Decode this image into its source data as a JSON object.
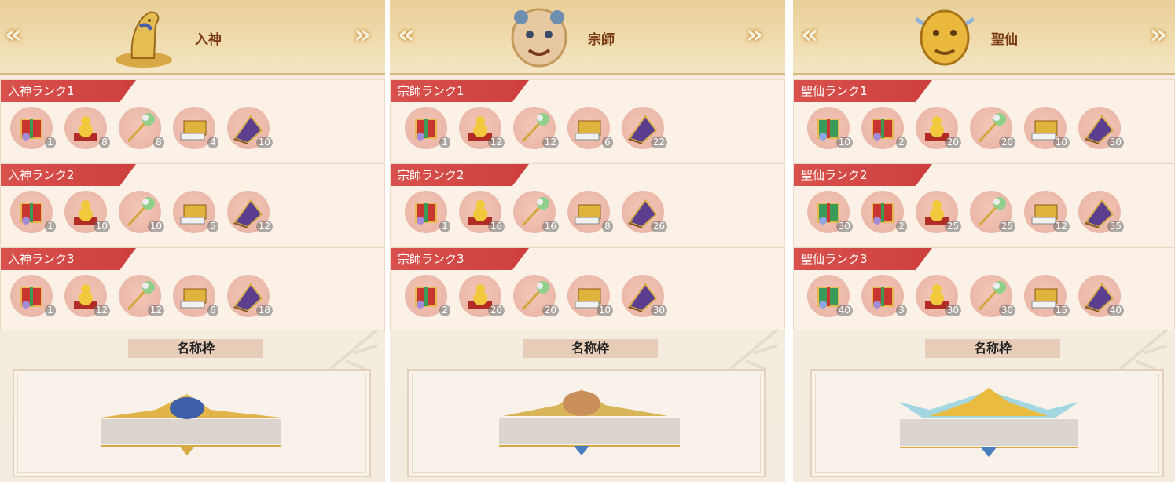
{
  "colors": {
    "accent_red": "#d24b47",
    "title_brown": "#7b3a12",
    "gold": "#e0b14a"
  },
  "nav": {
    "prev_icon": "«",
    "next_icon": "»"
  },
  "frame_label": "名称枠",
  "panels": [
    {
      "title": "入神",
      "emblem": "horse-emblem",
      "ranks": [
        {
          "label": "入神ランク1",
          "items": [
            {
              "icon": "gift-box-icon",
              "qty": "1"
            },
            {
              "icon": "gold-gourd-icon",
              "qty": "8"
            },
            {
              "icon": "jade-scepter-icon",
              "qty": "8"
            },
            {
              "icon": "gold-chest-icon",
              "qty": "4"
            },
            {
              "icon": "purple-book-icon",
              "qty": "10"
            }
          ]
        },
        {
          "label": "入神ランク2",
          "items": [
            {
              "icon": "gift-box-icon",
              "qty": "1"
            },
            {
              "icon": "gold-gourd-icon",
              "qty": "10"
            },
            {
              "icon": "jade-scepter-icon",
              "qty": "10"
            },
            {
              "icon": "gold-chest-icon",
              "qty": "5"
            },
            {
              "icon": "purple-book-icon",
              "qty": "12"
            }
          ]
        },
        {
          "label": "入神ランク3",
          "items": [
            {
              "icon": "gift-box-icon",
              "qty": "1"
            },
            {
              "icon": "gold-gourd-icon",
              "qty": "12"
            },
            {
              "icon": "jade-scepter-icon",
              "qty": "12"
            },
            {
              "icon": "gold-chest-icon",
              "qty": "6"
            },
            {
              "icon": "purple-book-icon",
              "qty": "18"
            }
          ]
        }
      ]
    },
    {
      "title": "宗師",
      "emblem": "tiger-face-emblem",
      "ranks": [
        {
          "label": "宗師ランク1",
          "items": [
            {
              "icon": "gift-box-icon",
              "qty": "1"
            },
            {
              "icon": "gold-gourd-icon",
              "qty": "12"
            },
            {
              "icon": "jade-scepter-icon",
              "qty": "12"
            },
            {
              "icon": "gold-chest-icon",
              "qty": "6"
            },
            {
              "icon": "purple-book-icon",
              "qty": "22"
            }
          ]
        },
        {
          "label": "宗師ランク2",
          "items": [
            {
              "icon": "gift-box-icon",
              "qty": "1"
            },
            {
              "icon": "gold-gourd-icon",
              "qty": "16"
            },
            {
              "icon": "jade-scepter-icon",
              "qty": "16"
            },
            {
              "icon": "gold-chest-icon",
              "qty": "8"
            },
            {
              "icon": "purple-book-icon",
              "qty": "26"
            }
          ]
        },
        {
          "label": "宗師ランク3",
          "items": [
            {
              "icon": "gift-box-icon",
              "qty": "2"
            },
            {
              "icon": "gold-gourd-icon",
              "qty": "20"
            },
            {
              "icon": "jade-scepter-icon",
              "qty": "20"
            },
            {
              "icon": "gold-chest-icon",
              "qty": "10"
            },
            {
              "icon": "purple-book-icon",
              "qty": "30"
            }
          ]
        }
      ]
    },
    {
      "title": "聖仙",
      "emblem": "golden-tiger-emblem",
      "ranks": [
        {
          "label": "聖仙ランク1",
          "items": [
            {
              "icon": "green-gift-box-icon",
              "qty": "10"
            },
            {
              "icon": "gift-box-icon",
              "qty": "2"
            },
            {
              "icon": "gold-gourd-icon",
              "qty": "20"
            },
            {
              "icon": "jade-scepter-icon",
              "qty": "20"
            },
            {
              "icon": "gold-chest-icon",
              "qty": "10"
            },
            {
              "icon": "purple-book-icon",
              "qty": "30"
            }
          ]
        },
        {
          "label": "聖仙ランク2",
          "items": [
            {
              "icon": "green-gift-box-icon",
              "qty": "30"
            },
            {
              "icon": "gift-box-icon",
              "qty": "2"
            },
            {
              "icon": "gold-gourd-icon",
              "qty": "25"
            },
            {
              "icon": "jade-scepter-icon",
              "qty": "25"
            },
            {
              "icon": "gold-chest-icon",
              "qty": "12"
            },
            {
              "icon": "purple-book-icon",
              "qty": "35"
            }
          ]
        },
        {
          "label": "聖仙ランク3",
          "items": [
            {
              "icon": "green-gift-box-icon",
              "qty": "40"
            },
            {
              "icon": "gift-box-icon",
              "qty": "3"
            },
            {
              "icon": "gold-gourd-icon",
              "qty": "30"
            },
            {
              "icon": "jade-scepter-icon",
              "qty": "30"
            },
            {
              "icon": "gold-chest-icon",
              "qty": "15"
            },
            {
              "icon": "purple-book-icon",
              "qty": "40"
            }
          ]
        }
      ]
    }
  ]
}
